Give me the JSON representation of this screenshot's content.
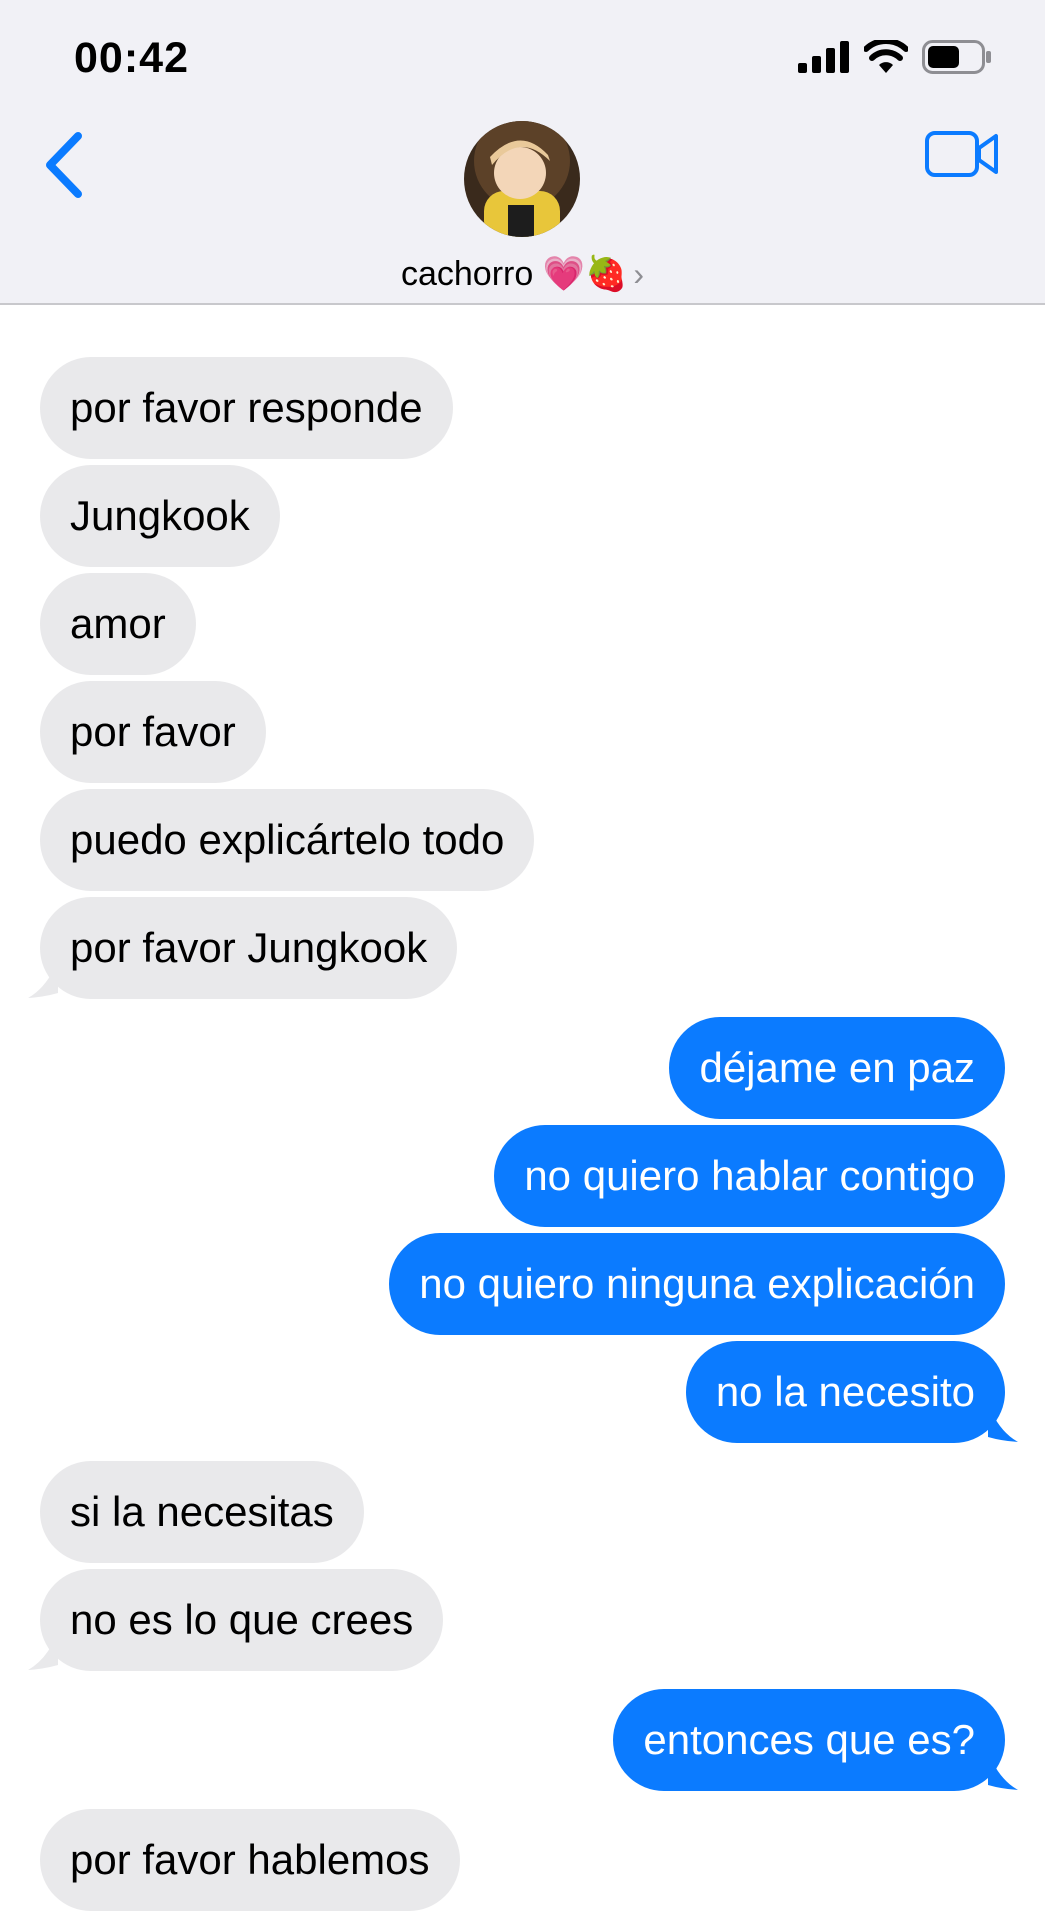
{
  "status_bar": {
    "time": "00:42",
    "battery_level": 0.6
  },
  "nav": {
    "contact_name": "cachorro 💗🍓",
    "chevron": "›",
    "back_icon": "chevron-left-icon",
    "video_icon": "video-camera-icon"
  },
  "colors": {
    "accent": "#0b7bff",
    "incoming_bubble": "#e9e9eb",
    "header_bg": "#f1f1f6"
  },
  "messages": [
    {
      "direction": "incoming",
      "text": "por favor responde"
    },
    {
      "direction": "incoming",
      "text": "Jungkook"
    },
    {
      "direction": "incoming",
      "text": "amor"
    },
    {
      "direction": "incoming",
      "text": "por favor"
    },
    {
      "direction": "incoming",
      "text": "puedo explicártelo todo"
    },
    {
      "direction": "incoming",
      "text": "por favor Jungkook"
    },
    {
      "direction": "outgoing",
      "text": "déjame en paz"
    },
    {
      "direction": "outgoing",
      "text": "no quiero hablar contigo"
    },
    {
      "direction": "outgoing",
      "text": "no quiero ninguna explicación"
    },
    {
      "direction": "outgoing",
      "text": "no la necesito"
    },
    {
      "direction": "incoming",
      "text": "si la necesitas"
    },
    {
      "direction": "incoming",
      "text": "no es lo que crees"
    },
    {
      "direction": "outgoing",
      "text": "entonces que es?"
    },
    {
      "direction": "incoming",
      "text": "por favor hablemos"
    }
  ]
}
